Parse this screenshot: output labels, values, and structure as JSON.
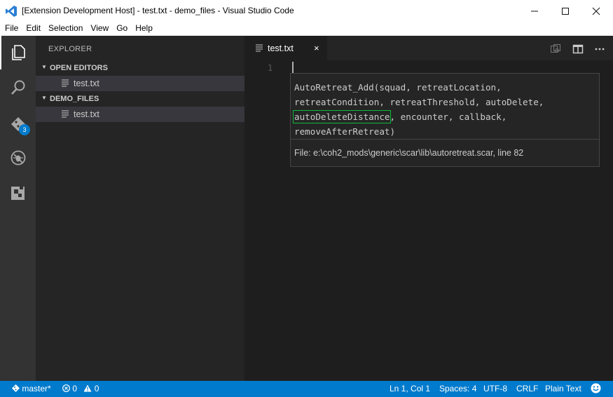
{
  "window": {
    "title": "[Extension Development Host] - test.txt - demo_files - Visual Studio Code",
    "controls": [
      "minimize-icon",
      "maximize-icon",
      "close-icon"
    ]
  },
  "menu": [
    "File",
    "Edit",
    "Selection",
    "View",
    "Go",
    "Help"
  ],
  "activity_bar": {
    "items": [
      "files-icon",
      "search-icon",
      "source-control-icon",
      "debug-icon",
      "extensions-icon"
    ],
    "scm_badge": "3"
  },
  "sidebar": {
    "title": "EXPLORER",
    "sections": [
      {
        "label": "OPEN EDITORS",
        "files": [
          "test.txt"
        ]
      },
      {
        "label": "DEMO_FILES",
        "files": [
          "test.txt"
        ]
      }
    ]
  },
  "editor": {
    "tab": {
      "label": "test.txt",
      "close": "×"
    },
    "line_number": "1",
    "hover": {
      "sig_before": "AutoRetreat_Add(squad, retreatLocation, retreatCondition, retreatThreshold, autoDelete, ",
      "sig_active": "autoDeleteDistance",
      "sig_after": ", encounter, callback, removeAfterRetreat)",
      "doc": "File: e:\\coh2_mods\\generic\\scar\\lib\\autoretreat.scar, line 82"
    }
  },
  "statusbar": {
    "branch": "master*",
    "errors": "0",
    "warnings": "0",
    "position": "Ln 1, Col 1",
    "spaces": "Spaces: 4",
    "encoding": "UTF-8",
    "eol": "CRLF",
    "language": "Plain Text"
  },
  "colors": {
    "accent": "#007acc",
    "active_param_outline": "#0cba3b"
  }
}
